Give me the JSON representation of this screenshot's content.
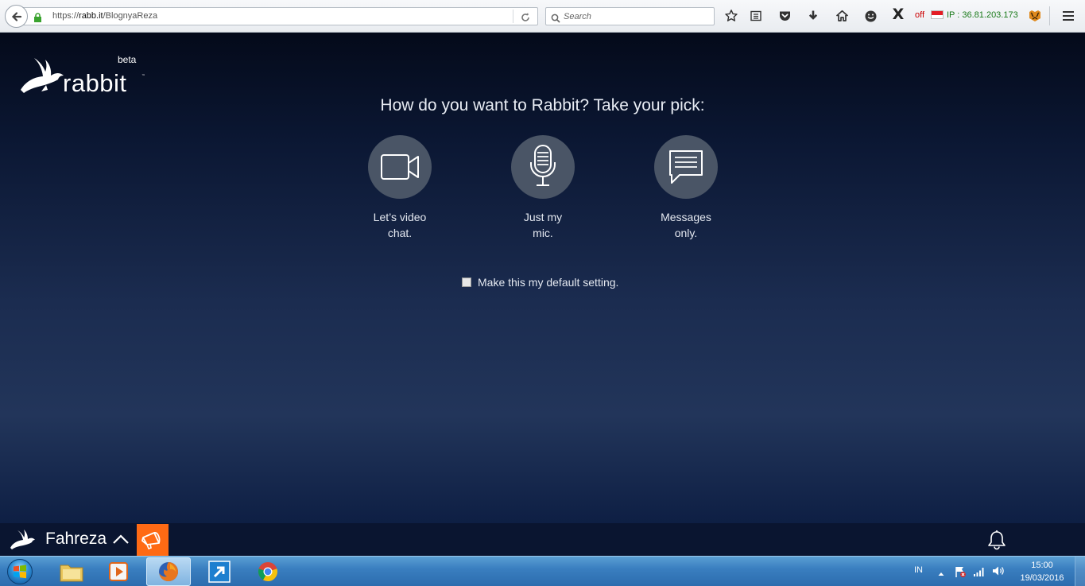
{
  "browser": {
    "url_prefix": "https://",
    "url_domain": "rabb.it",
    "url_path": "/BlognyaReza",
    "search_placeholder": "Search",
    "proxy_status": "off",
    "ip_label": "IP : 36.81.203.173",
    "x_glyph": "X"
  },
  "app": {
    "beta": "beta",
    "brand": "rabbit",
    "tm": "™",
    "headline": "How do you want to Rabbit? Take your pick:",
    "options": [
      {
        "label": "Let’s video chat."
      },
      {
        "label": "Just my mic."
      },
      {
        "label": "Messages only."
      }
    ],
    "default_setting_label": "Make this my default setting.",
    "username": "Fahreza"
  },
  "taskbar": {
    "language": "IN",
    "time": "15:00",
    "date": "19/03/2016"
  },
  "colors": {
    "accent_orange": "#ff6a14",
    "option_circle": "#4a5566",
    "ip_green": "#1a7a1a",
    "off_red": "#cc0000"
  }
}
